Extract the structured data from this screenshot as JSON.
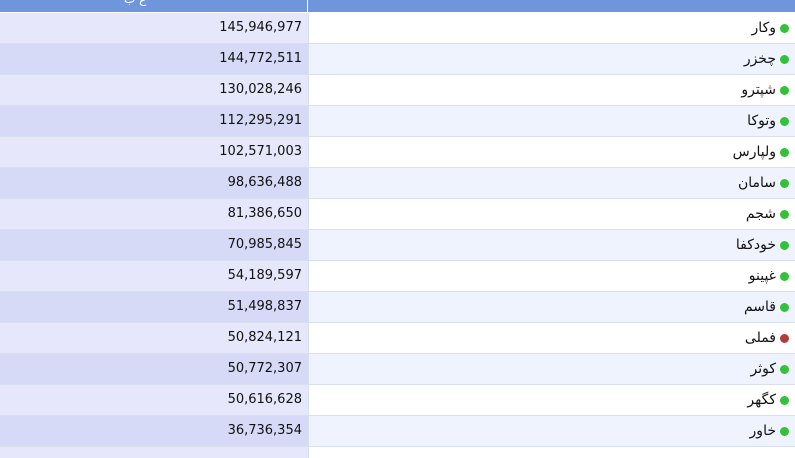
{
  "header": {
    "value_label": "ع ب",
    "name_label": ""
  },
  "colors": {
    "header_bg": "#6f95dc",
    "status_up": "#34c13a",
    "status_down": "#b23b3b"
  },
  "rows": [
    {
      "name": "وکار",
      "value": "145,946,977",
      "status": "up"
    },
    {
      "name": "چخزر",
      "value": "144,772,511",
      "status": "up"
    },
    {
      "name": "شپترو",
      "value": "130,028,246",
      "status": "up"
    },
    {
      "name": "وتوکا",
      "value": "112,295,291",
      "status": "up"
    },
    {
      "name": "ولپارس",
      "value": "102,571,003",
      "status": "up"
    },
    {
      "name": "سامان",
      "value": "98,636,488",
      "status": "up"
    },
    {
      "name": "شجم",
      "value": "81,386,650",
      "status": "up"
    },
    {
      "name": "خودکفا",
      "value": "70,985,845",
      "status": "up"
    },
    {
      "name": "غپینو",
      "value": "54,189,597",
      "status": "up"
    },
    {
      "name": "قاسم",
      "value": "51,498,837",
      "status": "up"
    },
    {
      "name": "فملی",
      "value": "50,824,121",
      "status": "down"
    },
    {
      "name": "کوثر",
      "value": "50,772,307",
      "status": "up"
    },
    {
      "name": "کگهر",
      "value": "50,616,628",
      "status": "up"
    },
    {
      "name": "خاور",
      "value": "36,736,354",
      "status": "up"
    },
    {
      "name": "",
      "value": "",
      "status": "up"
    }
  ]
}
